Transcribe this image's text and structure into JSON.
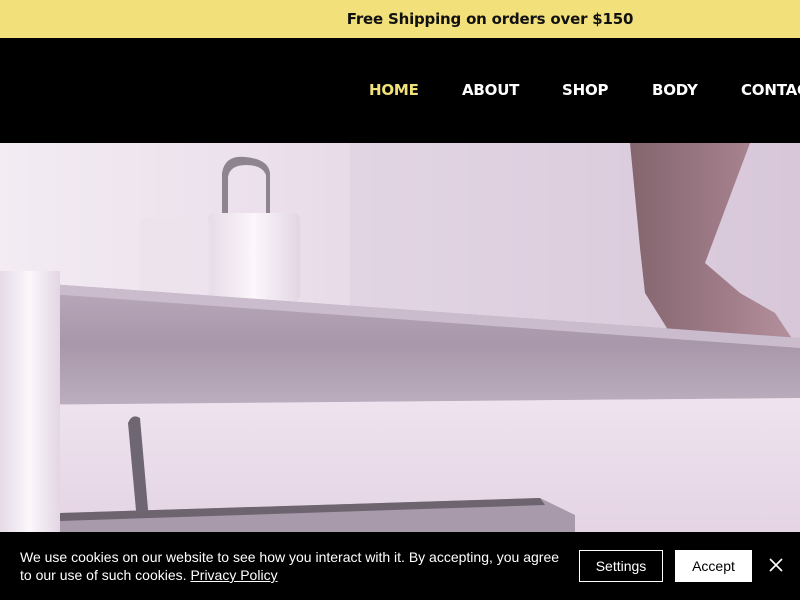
{
  "promo": {
    "text": "Free Shipping on orders over $150"
  },
  "nav": {
    "items": [
      {
        "label": "HOME",
        "active": true
      },
      {
        "label": "ABOUT",
        "active": false
      },
      {
        "label": "SHOP",
        "active": false
      },
      {
        "label": "BODY",
        "active": false
      },
      {
        "label": "CONTACT",
        "active": false
      }
    ]
  },
  "hero": {
    "image_icon": "bathroom-counter-photo"
  },
  "cookie_banner": {
    "text": "We use cookies on our website to see how you interact with it. By accepting, you agree to our use of such cookies.",
    "link_label": "Privacy Policy",
    "settings_label": "Settings",
    "accept_label": "Accept",
    "close_icon": "close-icon"
  },
  "colors": {
    "promo_bg": "#f2e07a",
    "nav_active": "#f2e07a",
    "header_bg": "#000000"
  }
}
